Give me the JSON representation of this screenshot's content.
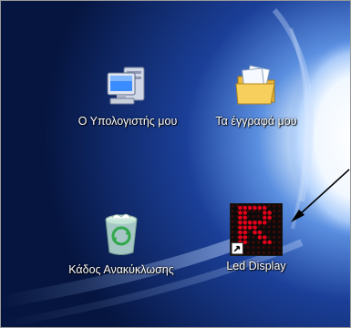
{
  "desktop": {
    "icons": [
      {
        "label": "Ο Υπολογιστής μου",
        "icon": "my-computer-icon"
      },
      {
        "label": "Τα έγγραφά μου",
        "icon": "my-documents-icon"
      },
      {
        "label": "Κάδος Ανακύκλωσης",
        "icon": "recycle-bin-icon"
      },
      {
        "label": "Led Display",
        "icon": "led-display-shortcut-icon"
      }
    ]
  },
  "colors": {
    "wallpaper_dark": "#081a4f",
    "wallpaper_glow": "#ffffff",
    "led_red": "#e0001a",
    "label_text": "#ffffff"
  }
}
